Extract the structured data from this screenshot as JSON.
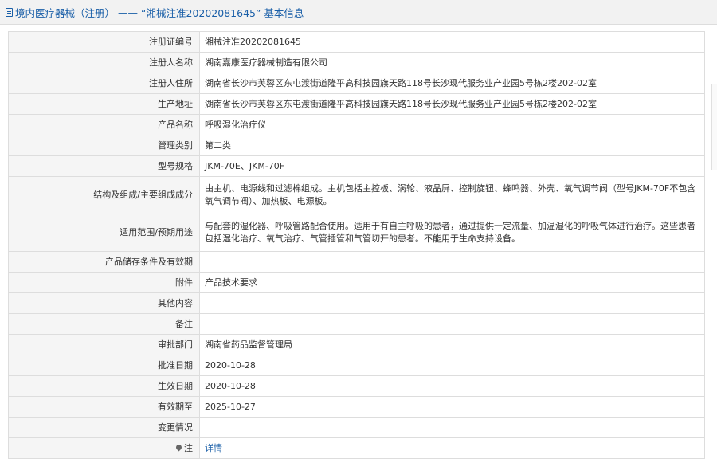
{
  "header": {
    "icon": "document-icon",
    "prefix": "境内医疗器械（注册）",
    "separator": "——",
    "title": "“湘械注准20202081645” 基本信息"
  },
  "rows": [
    {
      "label": "注册证编号",
      "value": "湘械注准20202081645"
    },
    {
      "label": "注册人名称",
      "value": "湖南嘉康医疗器械制造有限公司"
    },
    {
      "label": "注册人住所",
      "value": "湖南省长沙市芙蓉区东屯渡街道隆平高科技园旗天路118号长沙现代服务业产业园5号栋2楼202-02室"
    },
    {
      "label": "生产地址",
      "value": "湖南省长沙市芙蓉区东屯渡街道隆平高科技园旗天路118号长沙现代服务业产业园5号栋2楼202-02室"
    },
    {
      "label": "产品名称",
      "value": "呼吸湿化治疗仪"
    },
    {
      "label": "管理类别",
      "value": "第二类"
    },
    {
      "label": "型号规格",
      "value": "JKM-70E、JKM-70F"
    },
    {
      "label": "结构及组成/主要组成成分",
      "value": "由主机、电源线和过滤棉组成。主机包括主控板、涡轮、液晶屏、控制旋钮、蜂鸣器、外壳、氧气调节阀（型号JKM-70F不包含氧气调节阀）、加热板、电源板。"
    },
    {
      "label": "适用范围/预期用途",
      "value": "与配套的湿化器、呼吸管路配合使用。适用于有自主呼吸的患者，通过提供一定流量、加温湿化的呼吸气体进行治疗。这些患者包括湿化治疗、氧气治疗、气管插管和气管切开的患者。不能用于生命支持设备。"
    },
    {
      "label": "产品储存条件及有效期",
      "value": ""
    },
    {
      "label": "附件",
      "value": "产品技术要求"
    },
    {
      "label": "其他内容",
      "value": ""
    },
    {
      "label": "备注",
      "value": ""
    },
    {
      "label": "审批部门",
      "value": "湖南省药品监督管理局"
    },
    {
      "label": "批准日期",
      "value": "2020-10-28"
    },
    {
      "label": "生效日期",
      "value": "2020-10-28"
    },
    {
      "label": "有效期至",
      "value": "2025-10-27"
    },
    {
      "label": "变更情况",
      "value": ""
    }
  ],
  "note": {
    "icon": "pin-icon",
    "label": "注",
    "link_text": "详情"
  },
  "colors": {
    "link": "#1a5fa8",
    "label_bg": "#f5f5f5",
    "border": "#dddddd",
    "header_bg": "#f2f2f2"
  }
}
